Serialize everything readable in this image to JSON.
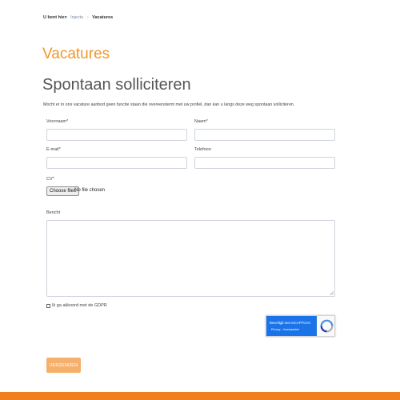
{
  "breadcrumb": {
    "lead": "U bent hier:",
    "home": "Injectu",
    "separator": "›",
    "current": "Vacatures"
  },
  "page": {
    "title": "Vacatures",
    "subtitle": "Spontaan solliciteren",
    "intro": "Mocht er in ons vacature aanbod geen functie staan die overeenstemt met uw profiel, dan kan u langs deze weg spontaan solliciteren."
  },
  "form": {
    "voornaam_label": "Voornaam*",
    "naam_label": "Naam*",
    "email_label": "E-mail*",
    "telefoon_label": "Telefoon",
    "cv_label": "CV*",
    "file_button": "Choose files",
    "file_status": "No file chosen",
    "bericht_label": "Bericht",
    "gdpr_label": "Ik ga akkoord met de GDPR",
    "submit_label": "VERZENDEN"
  },
  "recaptcha": {
    "title": "Beveiligd met reCAPTCHA",
    "privacy": "Privacy",
    "terms": "Voorwaarden",
    "separator": " - "
  },
  "colors": {
    "accent": "#f0962d",
    "button": "#f5b06c",
    "footer": "#f27f1e",
    "recaptcha_blue": "#1a73e8"
  },
  "icons": {
    "recaptcha_logo": "recaptcha-logo-icon",
    "resize": "resize-handle-icon"
  }
}
